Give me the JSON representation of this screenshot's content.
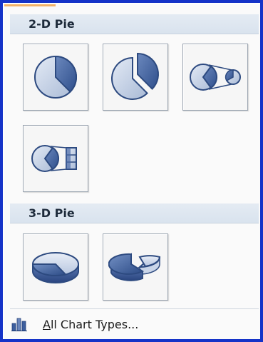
{
  "sections": {
    "pie2d": {
      "title": "2-D Pie",
      "items": [
        {
          "name": "pie-icon"
        },
        {
          "name": "exploded-pie-icon"
        },
        {
          "name": "pie-of-pie-icon"
        },
        {
          "name": "bar-of-pie-icon"
        }
      ]
    },
    "pie3d": {
      "title": "3-D Pie",
      "items": [
        {
          "name": "pie-3d-icon"
        },
        {
          "name": "exploded-pie-3d-icon"
        }
      ]
    }
  },
  "footer": {
    "label_first": "A",
    "label_rest": "ll Chart Types...",
    "icon": "column-chart-icon"
  },
  "colors": {
    "frame": "#1533c8",
    "pie_dark": "#3d5f9e",
    "pie_light": "#c7d3e6",
    "pie_stroke": "#2d4a80"
  }
}
